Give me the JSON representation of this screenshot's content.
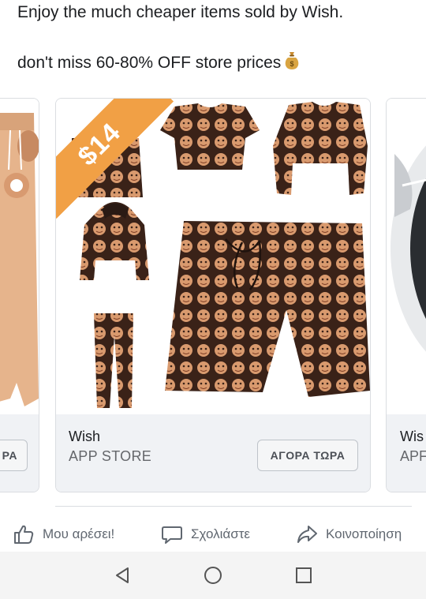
{
  "post": {
    "line1": "Enjoy the much cheaper items sold by Wish.",
    "line2": "don't miss 60-80% OFF store prices",
    "emoji_icon": "money-bag-icon"
  },
  "carousel": {
    "left_card": {
      "cta_label": "ΡΑ"
    },
    "main_card": {
      "price_badge": "$14",
      "title": "Wish",
      "subtitle": "APP STORE",
      "cta_label": "ΑΓΟΡΑ ΤΩΡΑ"
    },
    "right_card": {
      "title": "Wis",
      "subtitle": "APF"
    }
  },
  "actions": {
    "like": "Μου αρέσει!",
    "comment": "Σχολιάστε",
    "share": "Κοινοποίηση"
  },
  "navbar": {
    "back_icon": "back-icon",
    "home_icon": "home-icon",
    "recent_icon": "recent-apps-icon"
  },
  "colors": {
    "accent_orange": "#f1a045",
    "card_info_bg": "#f0f2f5",
    "muted": "#65676b"
  }
}
